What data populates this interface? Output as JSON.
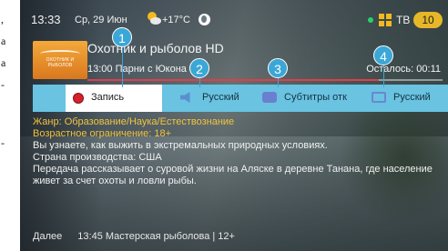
{
  "doc_strip": {
    "fragments": [
      ",",
      "а",
      "а",
      "-",
      "-"
    ]
  },
  "statusbar": {
    "time": "13:33",
    "date": "Ср, 29 Июн",
    "temperature": "+17°C",
    "tv_label": "ТВ",
    "channel_number": "10"
  },
  "channel": {
    "logo_text": "ОХОТНИК И РЫБОЛОВ",
    "title": "Охотник и рыболов HD",
    "program_time": "13:00",
    "program_name": "Парни с Юкона",
    "remaining": "Осталось: 00:11",
    "progress_fraction": 0.82
  },
  "options": {
    "record": "Запись",
    "audio": "Русский",
    "subtitles": "Субтитры отк",
    "language": "Русский"
  },
  "markers": [
    "1",
    "2",
    "3",
    "4"
  ],
  "description": {
    "genre": "Жанр: Образование/Наука/Естествознание",
    "age": "Возрастное ограничение: 18+",
    "line1": "Вы узнаете, как выжить в экстремальных природных условиях.",
    "country": "Страна производства: США",
    "line2": "Передача рассказывает о суровой жизни на Аляске в деревне Танана, где население",
    "line3": "живет за счет охоты и ловли рыбы."
  },
  "next": {
    "label": "Далее",
    "time": "13:45",
    "title": "Мастерская рыболова | 12+"
  },
  "colors": {
    "option_bar": "#69c3e1",
    "marker": "#3ba7d6",
    "highlight_text": "#f3c23d",
    "channel_badge": "#e6b728"
  }
}
